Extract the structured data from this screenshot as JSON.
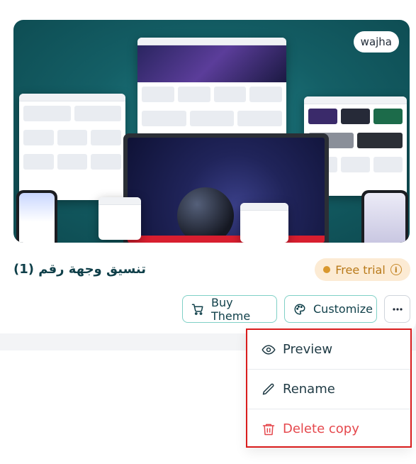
{
  "theme_card": {
    "brand_label": "wajha",
    "title": "تنسيق وجهة رقم (1)",
    "status_badge": "Free trial",
    "buy_button": "Buy Theme",
    "customize_button": "Customize",
    "more_button_icon": "more-horizontal-icon"
  },
  "menu": {
    "items": [
      {
        "label": "Preview",
        "icon": "eye-icon"
      },
      {
        "label": "Rename",
        "icon": "pencil-icon"
      },
      {
        "label": "Delete copy",
        "icon": "trash-icon"
      }
    ]
  },
  "colors": {
    "accent_border": "#7fd0c6",
    "badge_bg": "#fcebd4",
    "badge_text": "#b97a1a",
    "danger": "#e5484d",
    "highlight_outline": "#d91c1c"
  }
}
